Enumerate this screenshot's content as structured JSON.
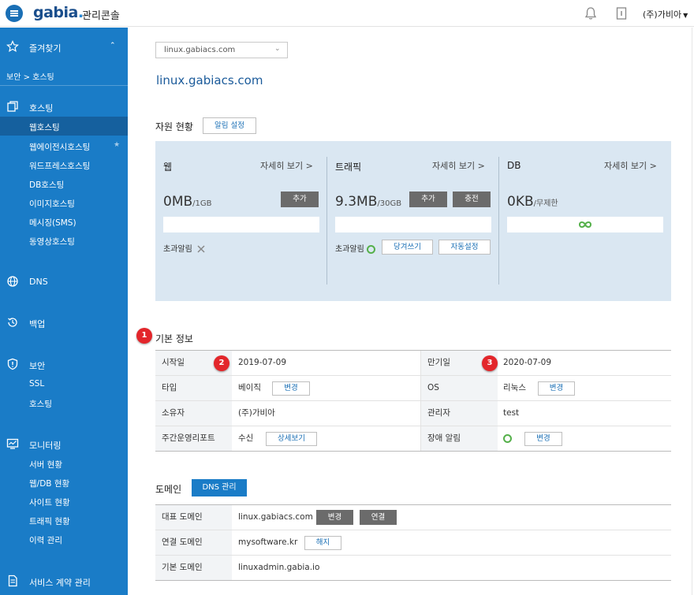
{
  "header": {
    "logo": "gabia",
    "logo_dot": ".",
    "console_title": "관리콘솔",
    "user": "(주)가비아"
  },
  "sidebar": {
    "favorites": "즐겨찾기",
    "breadcrumb": "보안 > 호스팅",
    "hosting": {
      "label": "호스팅",
      "items": [
        "웹호스팅",
        "웹에이전시호스팅",
        "워드프레스호스팅",
        "DB호스팅",
        "이미지호스팅",
        "메시징(SMS)",
        "동영상호스팅"
      ]
    },
    "dns": "DNS",
    "backup": "백업",
    "security": {
      "label": "보안",
      "items": [
        "SSL",
        "호스팅"
      ]
    },
    "monitoring": {
      "label": "모니터링",
      "items": [
        "서버 현황",
        "웹/DB 현황",
        "사이트 현황",
        "트래픽 현황",
        "이력 관리"
      ]
    },
    "contract": "서비스 계약 관리"
  },
  "main": {
    "domain_select": "linux.gabiacs.com",
    "title": "linux.gabiacs.com",
    "resources": {
      "heading": "자원 현황",
      "alarm_setting": "알림 설정",
      "more": "자세히 보기 >",
      "web": {
        "title": "웹",
        "value": "0MB",
        "unit": "/1GB",
        "add": "추가",
        "alarm": "초과알림"
      },
      "traffic": {
        "title": "트래픽",
        "value": "9.3MB",
        "unit": "/30GB",
        "add": "추가",
        "charge": "충전",
        "alarm": "초과알림",
        "pull": "당겨쓰기",
        "auto": "자동설정"
      },
      "db": {
        "title": "DB",
        "value": "0KB",
        "unit": "/무제한"
      }
    },
    "basic": {
      "heading": "기본 정보",
      "start_label": "시작일",
      "start": "2019-07-09",
      "expire_label": "만기일",
      "expire": "2020-07-09",
      "type_label": "타입",
      "type": "베이직",
      "type_btn": "변경",
      "os_label": "OS",
      "os": "리눅스",
      "os_btn": "변경",
      "owner_label": "소유자",
      "owner": "(주)가비아",
      "admin_label": "관리자",
      "admin": "test",
      "report_label": "주간운영리포트",
      "report": "수신",
      "report_btn": "상세보기",
      "fault_label": "장애 알림",
      "fault_btn": "변경"
    },
    "badges": [
      "1",
      "2",
      "3"
    ],
    "domain": {
      "heading": "도메인",
      "dns_btn": "DNS 관리",
      "rep_label": "대표 도메인",
      "rep": "linux.gabiacs.com",
      "rep_change": "변경",
      "rep_connect": "연결",
      "conn_label": "연결 도메인",
      "conn": "mysoftware.kr",
      "conn_btn": "해지",
      "base_label": "기본 도메인",
      "base": "linuxadmin.gabia.io"
    }
  }
}
